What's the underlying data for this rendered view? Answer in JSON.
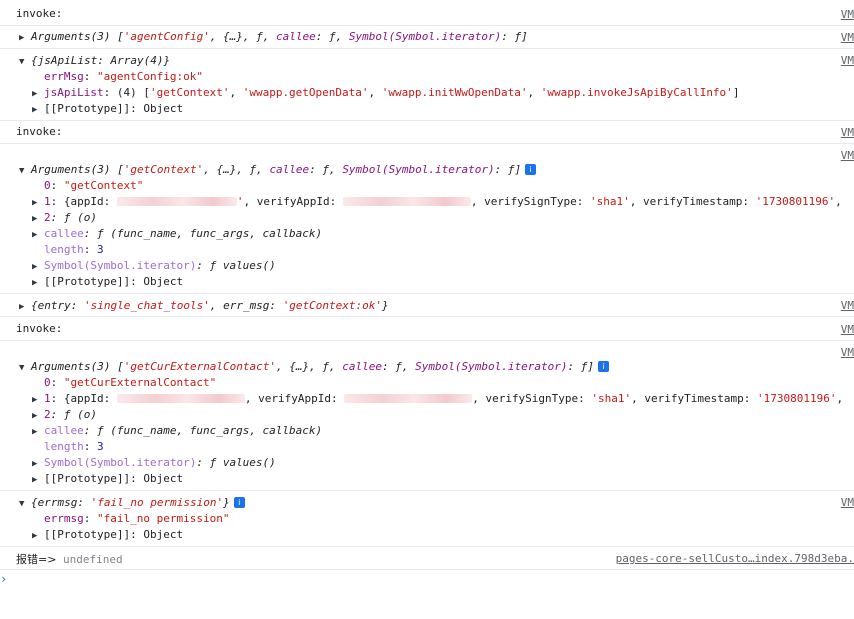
{
  "source_link": "VM",
  "source_link_last": "pages-core-sellCusto…index.798d3eba.",
  "blocks": {
    "b1": {
      "log": "invoke:"
    },
    "b2": {
      "summary_prefix": "Arguments(3) [",
      "arg0": "'agentConfig'",
      "rest": ", {…}, ƒ, ",
      "callee_key": "callee",
      "callee_val": ": ƒ, ",
      "sym_key": "Symbol(Symbol.iterator)",
      "sym_val": ": ƒ]"
    },
    "b3": {
      "summary": "{jsApiList: Array(4)}",
      "errMsg_key": "errMsg",
      "errMsg_val": "\"agentConfig:ok\"",
      "jsApiList_key": "jsApiList",
      "jsApiList_prefix": ": (4) [",
      "api0": "'getContext'",
      "api1": "'wwapp.getOpenData'",
      "api2": "'wwapp.initWwOpenData'",
      "api3": "'wwapp.invokeJsApiByCallInfo'",
      "jsApiList_suffix": "]",
      "proto": "[[Prototype]]: Object"
    },
    "b4": {
      "log": "invoke:"
    },
    "b5": {
      "summary_prefix": "Arguments(3) [",
      "arg0": "'getContext'",
      "rest": ", {…}, ƒ, ",
      "callee_key": "callee",
      "callee_val": ": ƒ, ",
      "sym_key": "Symbol(Symbol.iterator)",
      "sym_val": ": ƒ]",
      "badge": "i",
      "p0_key": "0",
      "p0_val": "\"getContext\"",
      "p1_key": "1",
      "p1_a": ": {appId: ",
      "p1_b": ", verifyAppId: ",
      "p1_c": ", verifySignType: ",
      "p1_sign": "'sha1'",
      "p1_d": ", verifyTimestamp: ",
      "p1_ts": "'1730801196'",
      "p1_e": ",",
      "p2_key": "2",
      "p2_val": ": ƒ (o)",
      "callee_row_key": "callee",
      "callee_row_val": ": ƒ (func_name, func_args, callback)",
      "length_key": "length",
      "length_val": "3",
      "symrow_key": "Symbol(Symbol.iterator)",
      "symrow_val": ": ƒ values()",
      "proto": "[[Prototype]]: Object"
    },
    "b6": {
      "pre": "{entry: ",
      "entry": "'single_chat_tools'",
      "mid": ", err_msg: ",
      "err": "'getContext:ok'",
      "post": "}"
    },
    "b7": {
      "log": "invoke:"
    },
    "b8": {
      "summary_prefix": "Arguments(3) [",
      "arg0": "'getCurExternalContact'",
      "rest": ", {…}, ƒ, ",
      "callee_key": "callee",
      "callee_val": ": ƒ, ",
      "sym_key": "Symbol(Symbol.iterator)",
      "sym_val": ": ƒ]",
      "badge": "i",
      "p0_key": "0",
      "p0_val": "\"getCurExternalContact\"",
      "p1_key": "1",
      "p1_a": ": {appId: ",
      "p1_b": ", verifyAppId: ",
      "p1_c": ", verifySignType: ",
      "p1_sign": "'sha1'",
      "p1_d": ", verifyTimestamp: ",
      "p1_ts": "'1730801196'",
      "p1_e": ",",
      "p2_key": "2",
      "p2_val": ": ƒ (o)",
      "callee_row_key": "callee",
      "callee_row_val": ": ƒ (func_name, func_args, callback)",
      "length_key": "length",
      "length_val": "3",
      "symrow_key": "Symbol(Symbol.iterator)",
      "symrow_val": ": ƒ values()",
      "proto": "[[Prototype]]: Object"
    },
    "b9": {
      "summary_pre": "{errmsg: ",
      "summary_val": "'fail_no permission'",
      "summary_post": "}",
      "badge": "i",
      "errmsg_key": "errmsg",
      "errmsg_val": "\"fail_no permission\"",
      "proto": "[[Prototype]]: Object"
    },
    "b10": {
      "label": "报错=>",
      "value": " undefined"
    }
  },
  "prompt_glyph": "›"
}
